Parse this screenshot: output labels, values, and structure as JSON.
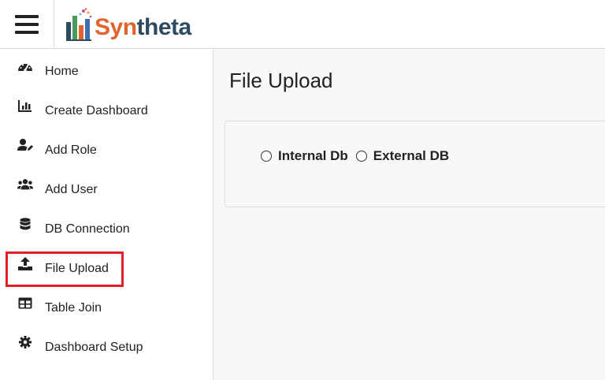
{
  "header": {
    "menu_icon": "hamburger-menu-icon",
    "logo": {
      "part1": "Syn",
      "part2": "theta",
      "colors": {
        "syn": "#e0642c",
        "theta": "#2d4a5e"
      }
    }
  },
  "sidebar": {
    "items": [
      {
        "label": "Home",
        "icon": "dashboard-gauge-icon"
      },
      {
        "label": "Create Dashboard",
        "icon": "bar-chart-icon"
      },
      {
        "label": "Add Role",
        "icon": "user-edit-icon"
      },
      {
        "label": "Add User",
        "icon": "users-icon"
      },
      {
        "label": "DB Connection",
        "icon": "database-icon"
      },
      {
        "label": "File Upload",
        "icon": "upload-icon"
      },
      {
        "label": "Table Join",
        "icon": "table-icon"
      },
      {
        "label": "Dashboard Setup",
        "icon": "gear-icon"
      }
    ],
    "highlighted_item": "File Upload",
    "highlight_color": "#e21f26"
  },
  "main": {
    "title": "File Upload",
    "db_options": [
      {
        "label": "Internal Db",
        "selected": false
      },
      {
        "label": "External DB",
        "selected": false
      }
    ]
  }
}
